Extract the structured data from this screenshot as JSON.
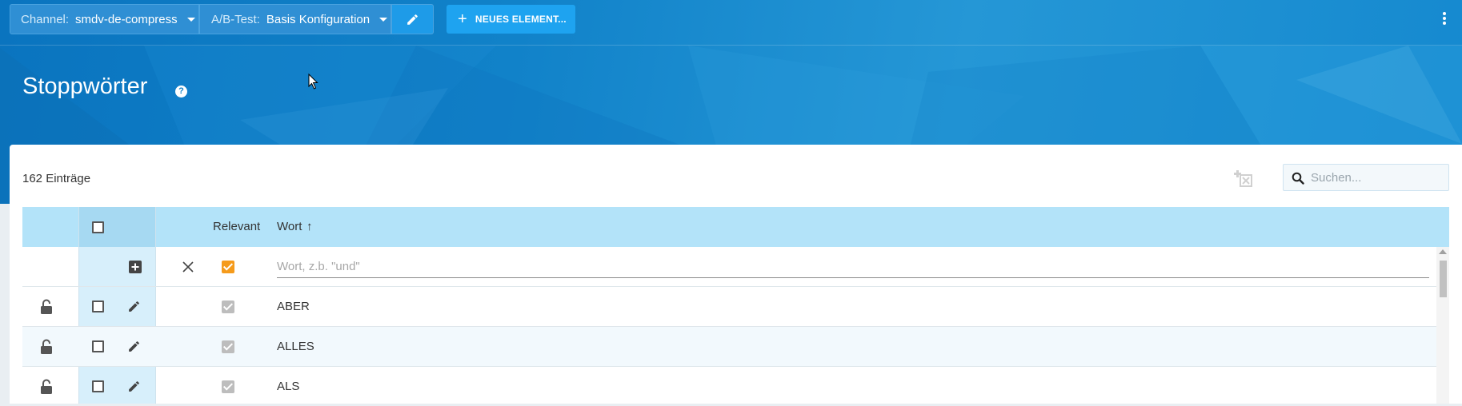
{
  "toolbar": {
    "channel_key": "Channel:",
    "channel_value": "smdv-de-compress",
    "abtest_key": "A/B-Test:",
    "abtest_value": "Basis Konfiguration",
    "new_element_label": "NEUES ELEMENT..."
  },
  "page": {
    "title": "Stoppwörter",
    "help_glyph": "?"
  },
  "list": {
    "count_label": "162 Einträge",
    "search_placeholder": "Suchen...",
    "columns": {
      "relevant": "Relevant",
      "word": "Wort",
      "sort_glyph": "↑"
    },
    "new_row": {
      "word_placeholder": "Wort, z.b. \"und\"",
      "relevant_checked": true
    },
    "rows": [
      {
        "word": "ABER",
        "relevant": true,
        "locked": false
      },
      {
        "word": "ALLES",
        "relevant": true,
        "locked": false
      },
      {
        "word": "ALS",
        "relevant": true,
        "locked": false
      }
    ]
  },
  "colors": {
    "header_blue": "#0a74bf",
    "accent_button": "#1ea3f0",
    "table_header": "#b3e3f9",
    "new_row_checkbox": "#f59b1b"
  }
}
